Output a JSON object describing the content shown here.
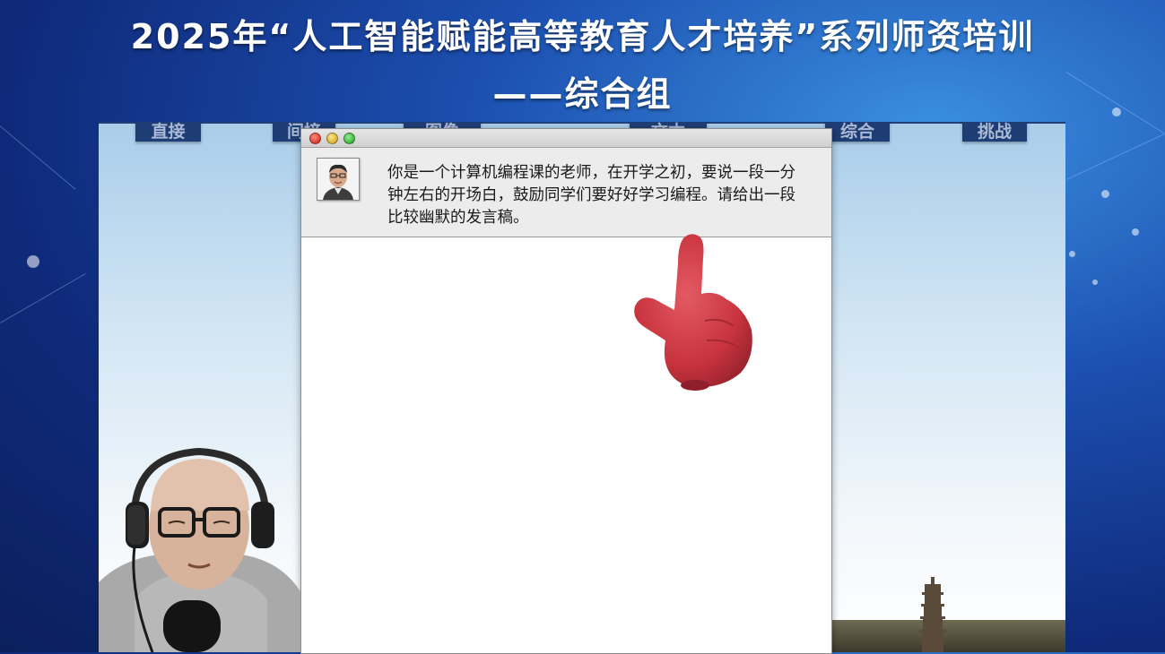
{
  "header": {
    "title_line1": "2025年“人工智能赋能高等教育人才培养”系列师资培训",
    "title_line2": "——综合组"
  },
  "slide_nav": {
    "tabs": [
      "直接",
      "间接",
      "图像",
      "文本",
      "综合",
      "挑战"
    ]
  },
  "chat_window": {
    "prompt_text": "你是一个计算机编程课的老师，在开学之初，要说一段一分钟左右的开场白，鼓励同学们要好好学习编程。请给出一段比较幽默的发言稿。"
  },
  "icons": {
    "pointer": "pointing-hand-icon",
    "avatar": "user-avatar-icon",
    "window_buttons": [
      "close-icon",
      "minimize-icon",
      "maximize-icon"
    ]
  },
  "colors": {
    "nav_tab_bg": "#1f3d75",
    "hand": "#c8333e",
    "background_blue": "#1c4fb0"
  }
}
